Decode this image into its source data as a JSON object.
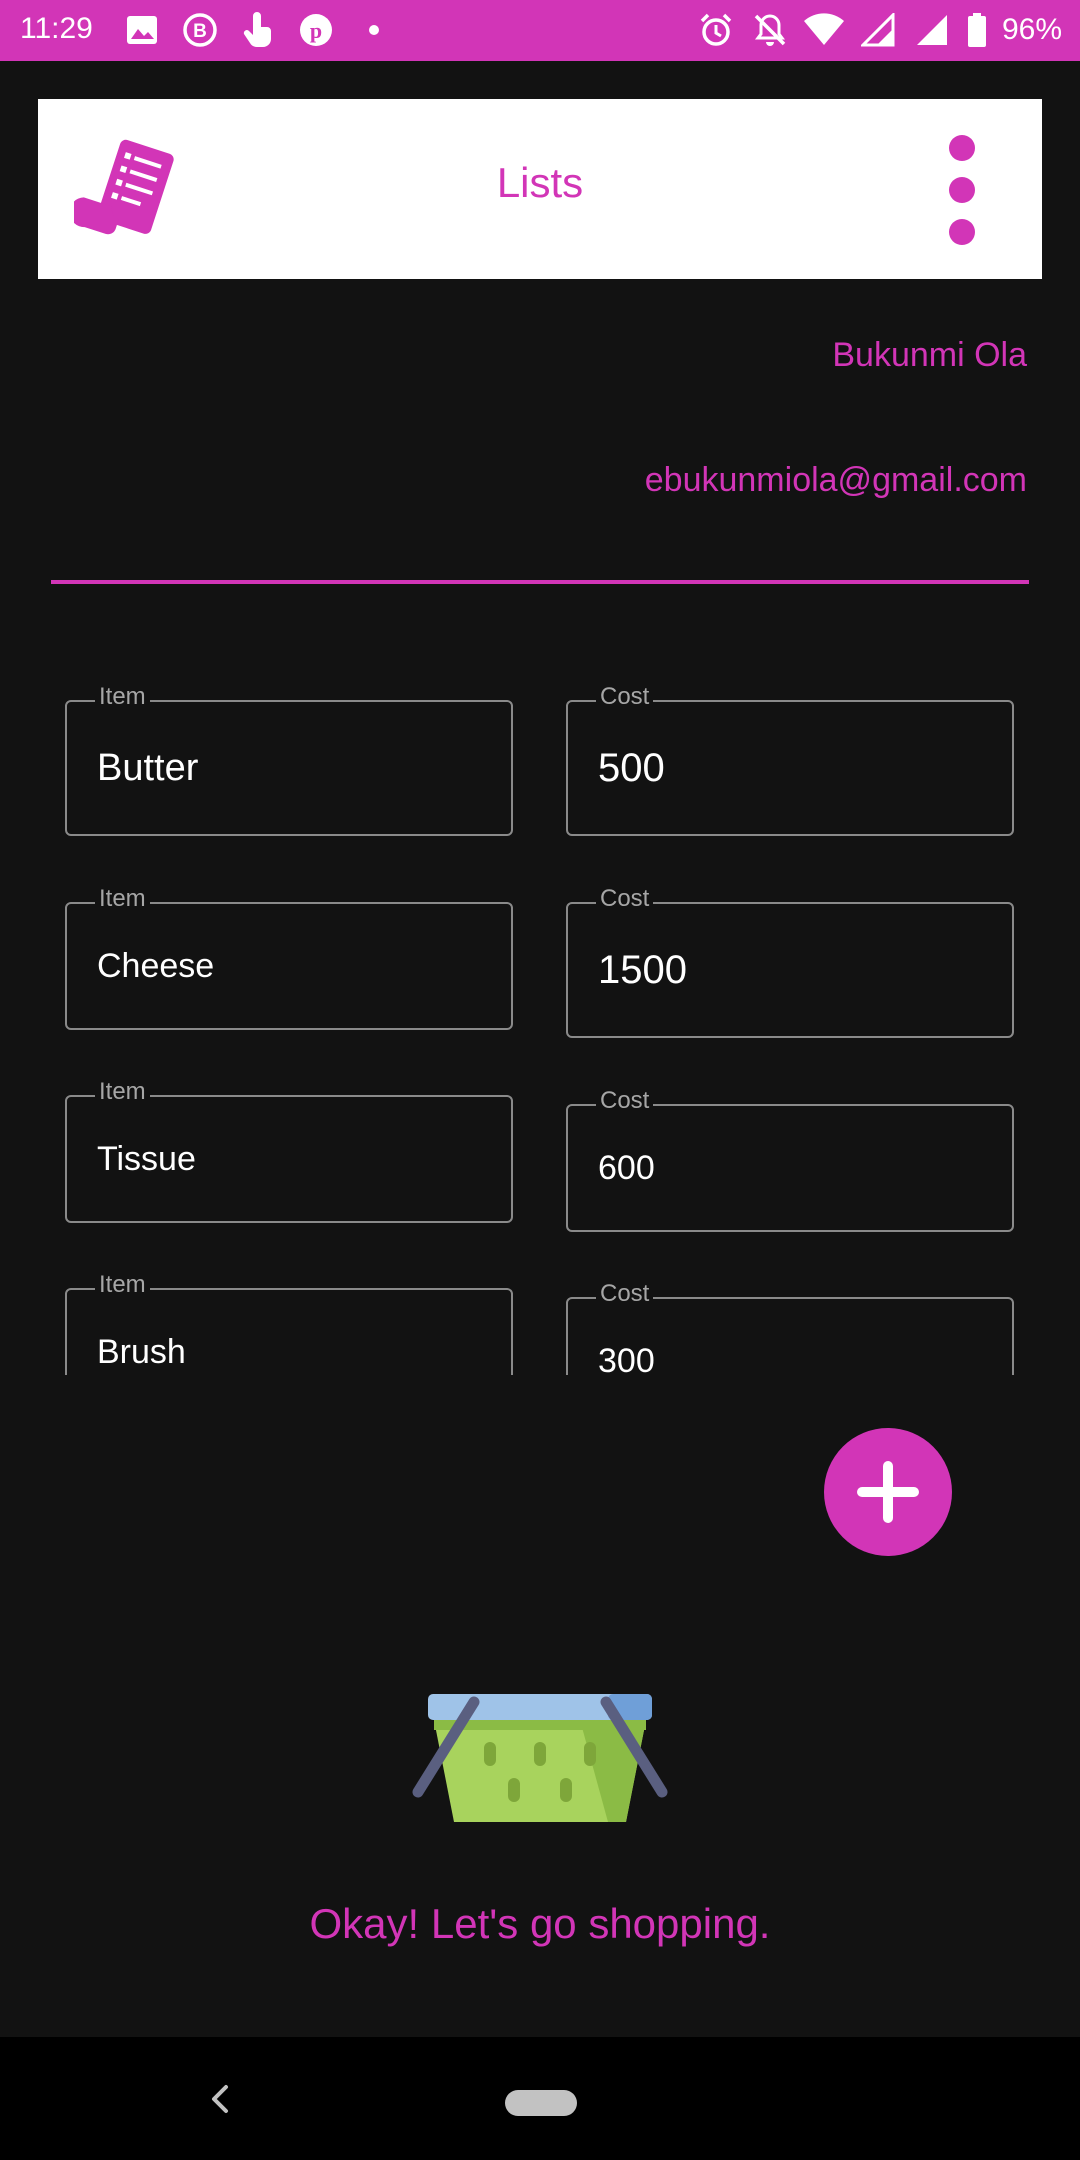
{
  "status_bar": {
    "time": "11:29",
    "battery": "96%",
    "left_icons": [
      "image-icon",
      "b-notification-icon",
      "touch-icon",
      "pinterest-icon",
      "dot-icon"
    ],
    "right_icons": [
      "alarm-icon",
      "bell-off-icon",
      "wifi-icon",
      "signal-icon",
      "signal-icon-2",
      "battery-icon"
    ]
  },
  "header": {
    "title": "Lists",
    "logo_icon": "receipt-list-icon",
    "menu_icon": "more-vert-icon"
  },
  "profile": {
    "name": "Bukunmi Ola",
    "email": "ebukunmiola@gmail.com"
  },
  "list": {
    "rows": [
      {
        "item_label": "Item",
        "item_value": "Butter",
        "cost_label": "Cost",
        "cost_value": "500"
      },
      {
        "item_label": "Item",
        "item_value": "Cheese",
        "cost_label": "Cost",
        "cost_value": "1500"
      },
      {
        "item_label": "Item",
        "item_value": "Tissue",
        "cost_label": "Cost",
        "cost_value": "600"
      },
      {
        "item_label": "Item",
        "item_value": "Brush",
        "cost_label": "Cost",
        "cost_value": "300"
      }
    ]
  },
  "fab": {
    "icon": "plus-icon"
  },
  "empty_state": {
    "icon": "shopping-basket-icon",
    "message": "Okay! Let's go shopping."
  },
  "colors": {
    "accent": "#D235B7",
    "background": "#121212",
    "surface": "#FFFFFF"
  }
}
